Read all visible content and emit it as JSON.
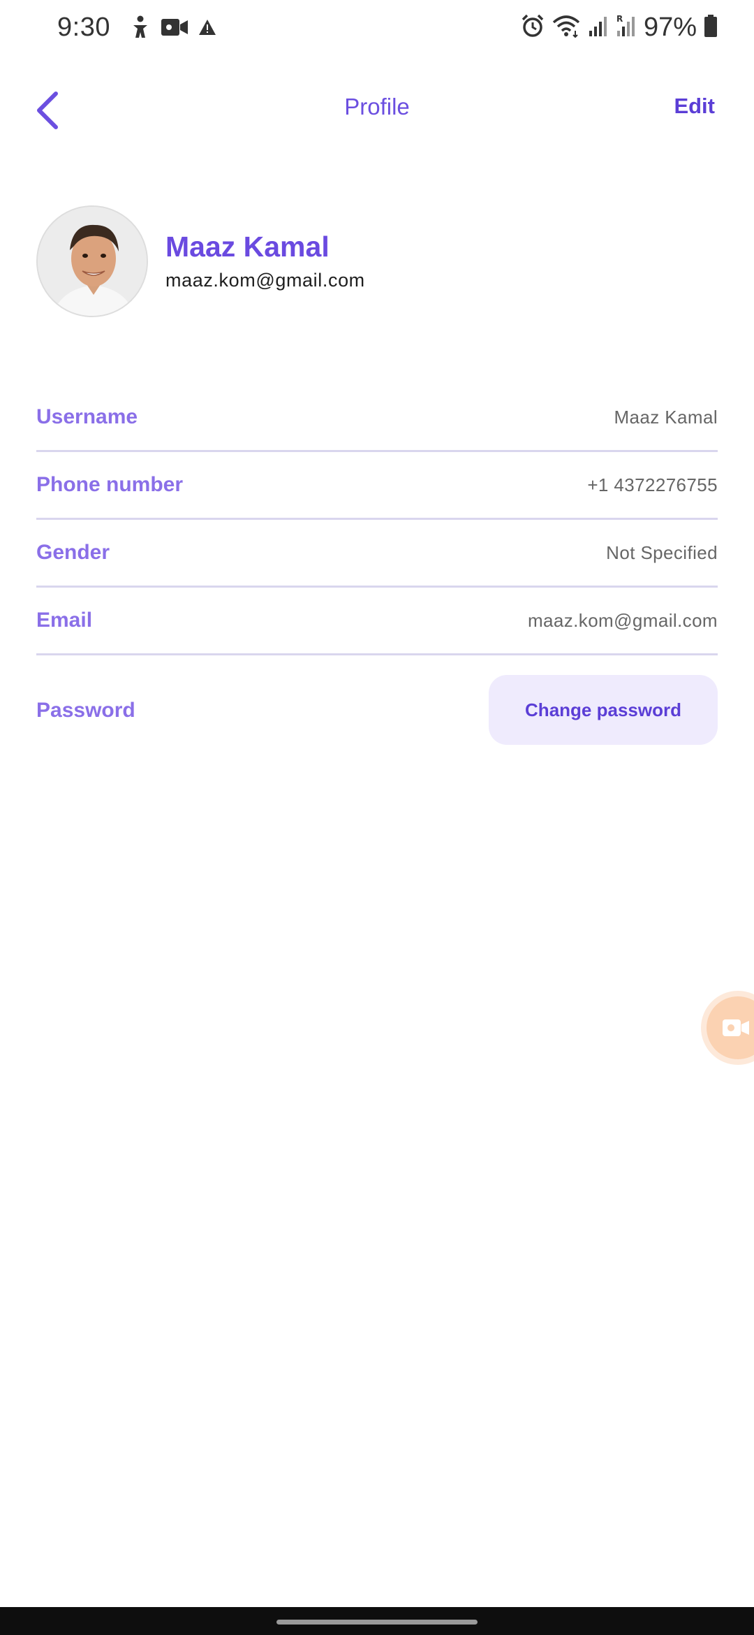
{
  "status_bar": {
    "time": "9:30",
    "battery_percent": "97%",
    "left_icons": [
      "accessibility-icon",
      "video-camera-icon",
      "warning-icon"
    ],
    "right_icons": [
      "alarm-icon",
      "wifi-icon",
      "signal-icon",
      "signal-roaming-icon",
      "battery-icon"
    ]
  },
  "header": {
    "title": "Profile",
    "edit_label": "Edit",
    "back_icon": "chevron-left-icon"
  },
  "profile": {
    "name": "Maaz Kamal",
    "email": "maaz.kom@gmail.com"
  },
  "fields": [
    {
      "label": "Username",
      "value": "Maaz Kamal"
    },
    {
      "label": "Phone number",
      "value": "+1 4372276755"
    },
    {
      "label": "Gender",
      "value": "Not Specified"
    },
    {
      "label": "Email",
      "value": "maaz.kom@gmail.com"
    }
  ],
  "password": {
    "label": "Password",
    "button_label": "Change password"
  },
  "colors": {
    "accent": "#6b4fe0",
    "label": "#8a6fe8",
    "divider": "#d9d6ee",
    "button_bg": "#efebfd",
    "floating_bubble": "#fbd2b2"
  }
}
